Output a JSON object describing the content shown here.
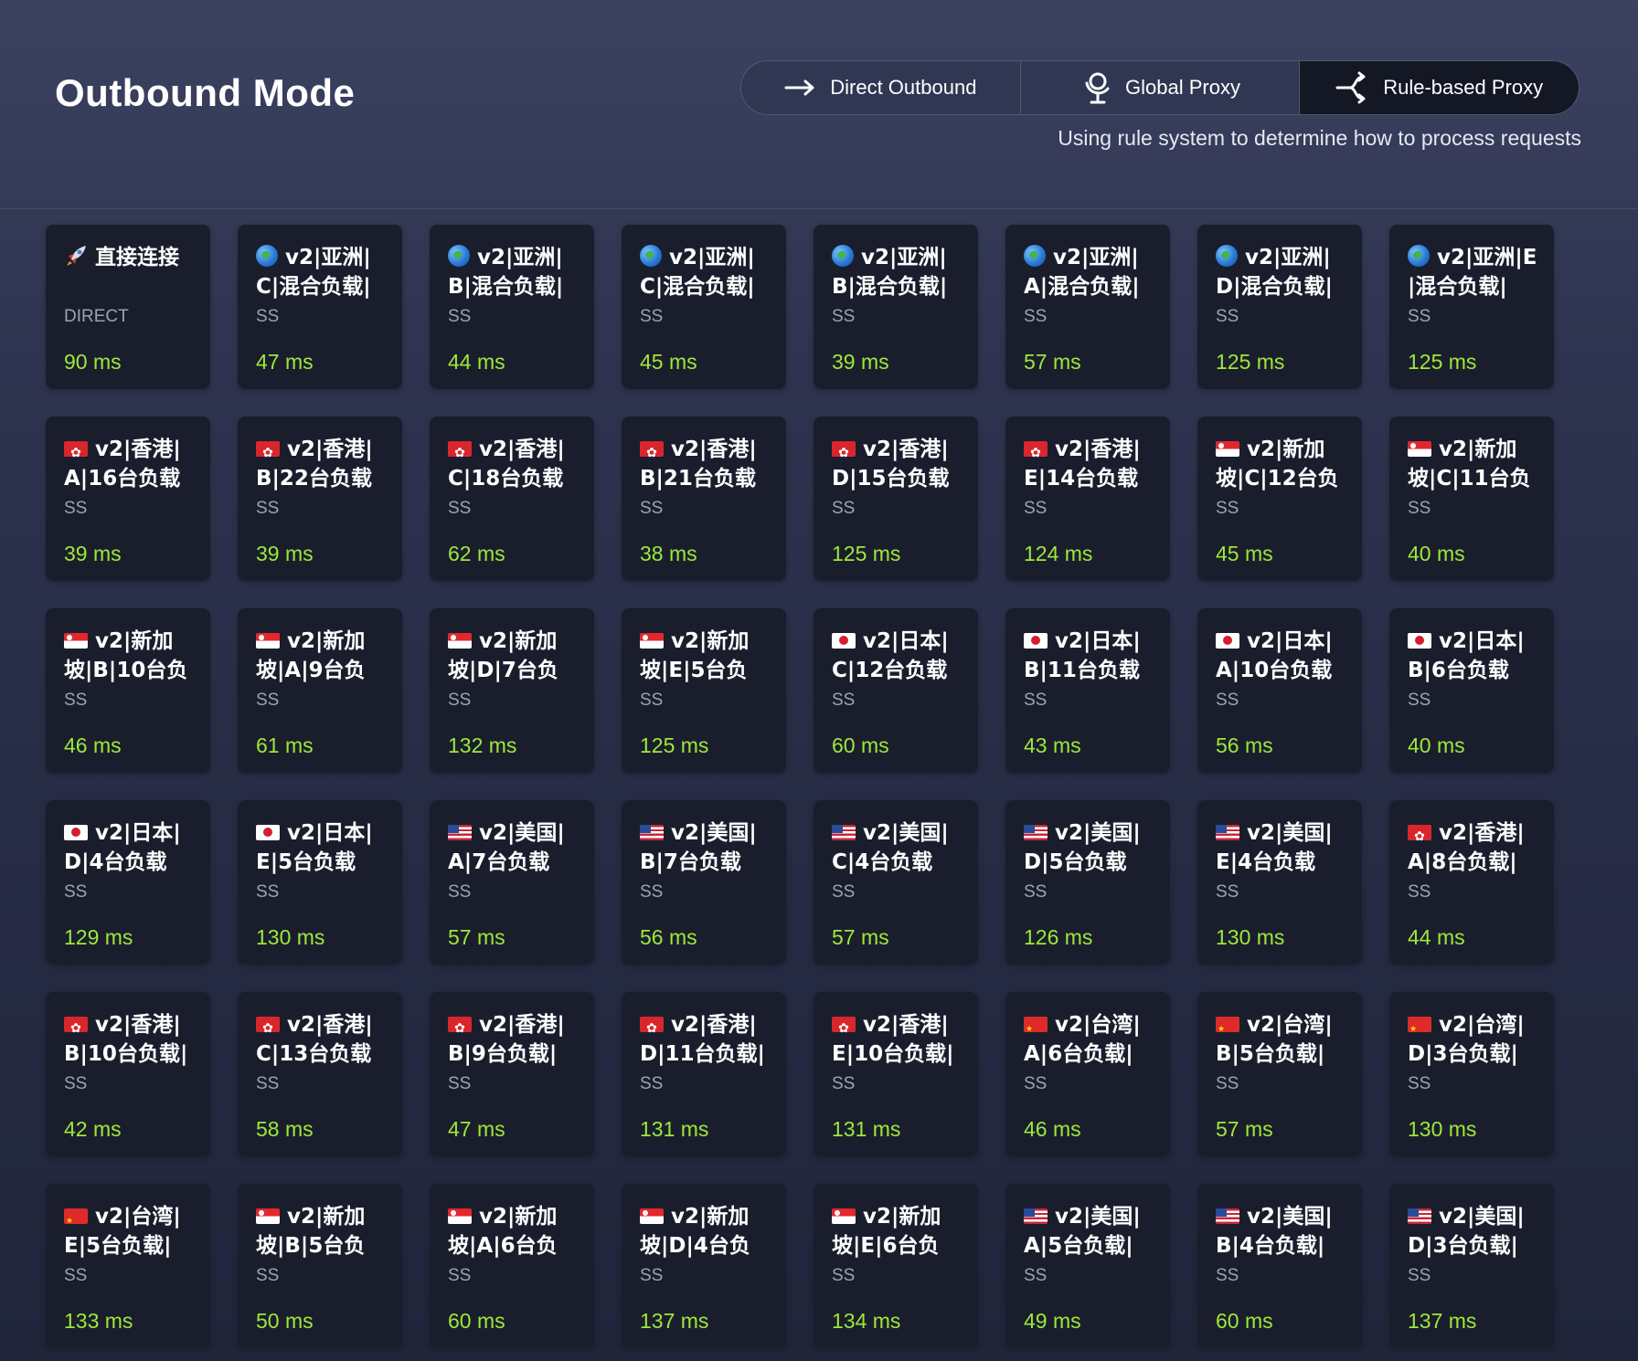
{
  "header": {
    "title": "Outbound Mode",
    "modes": [
      {
        "label": "Direct Outbound",
        "icon": "arrow-right-icon",
        "active": false
      },
      {
        "label": "Global Proxy",
        "icon": "globe-pin-icon",
        "active": false
      },
      {
        "label": "Rule-based Proxy",
        "icon": "split-route-icon",
        "active": true
      }
    ],
    "description": "Using rule system to determine how to process requests"
  },
  "colors": {
    "delay_good": "#9ee83a",
    "card_bg": "#1a1e2c",
    "active_mode_bg": "#141825"
  },
  "proxies": [
    {
      "flag": "rocket",
      "name": "直接连接",
      "type": "DIRECT",
      "delay": "90 ms"
    },
    {
      "flag": "globe",
      "name": "v2|亚洲|C|混合负载|",
      "type": "SS",
      "delay": "47 ms"
    },
    {
      "flag": "globe",
      "name": "v2|亚洲|B|混合负载|",
      "type": "SS",
      "delay": "44 ms"
    },
    {
      "flag": "globe",
      "name": "v2|亚洲|C|混合负载|",
      "type": "SS",
      "delay": "45 ms"
    },
    {
      "flag": "globe",
      "name": "v2|亚洲|B|混合负载|",
      "type": "SS",
      "delay": "39 ms"
    },
    {
      "flag": "globe",
      "name": "v2|亚洲|A|混合负载|",
      "type": "SS",
      "delay": "57 ms"
    },
    {
      "flag": "globe",
      "name": "v2|亚洲|D|混合负载|",
      "type": "SS",
      "delay": "125 ms"
    },
    {
      "flag": "globe",
      "name": "v2|亚洲|E|混合负载|",
      "type": "SS",
      "delay": "125 ms"
    },
    {
      "flag": "hk",
      "name": "v2|香港|A|16台负载",
      "type": "SS",
      "delay": "39 ms"
    },
    {
      "flag": "hk",
      "name": "v2|香港|B|22台负载",
      "type": "SS",
      "delay": "39 ms"
    },
    {
      "flag": "hk",
      "name": "v2|香港|C|18台负载",
      "type": "SS",
      "delay": "62 ms"
    },
    {
      "flag": "hk",
      "name": "v2|香港|B|21台负载",
      "type": "SS",
      "delay": "38 ms"
    },
    {
      "flag": "hk",
      "name": "v2|香港|D|15台负载",
      "type": "SS",
      "delay": "125 ms"
    },
    {
      "flag": "hk",
      "name": "v2|香港|E|14台负载",
      "type": "SS",
      "delay": "124 ms"
    },
    {
      "flag": "sg",
      "name": "v2|新加坡|C|12台负",
      "type": "SS",
      "delay": "45 ms"
    },
    {
      "flag": "sg",
      "name": "v2|新加坡|C|11台负",
      "type": "SS",
      "delay": "40 ms"
    },
    {
      "flag": "sg",
      "name": "v2|新加坡|B|10台负",
      "type": "SS",
      "delay": "46 ms"
    },
    {
      "flag": "sg",
      "name": "v2|新加坡|A|9台负",
      "type": "SS",
      "delay": "61 ms"
    },
    {
      "flag": "sg",
      "name": "v2|新加坡|D|7台负",
      "type": "SS",
      "delay": "132 ms"
    },
    {
      "flag": "sg",
      "name": "v2|新加坡|E|5台负",
      "type": "SS",
      "delay": "125 ms"
    },
    {
      "flag": "jp",
      "name": "v2|日本|C|12台负载",
      "type": "SS",
      "delay": "60 ms"
    },
    {
      "flag": "jp",
      "name": "v2|日本|B|11台负载",
      "type": "SS",
      "delay": "43 ms"
    },
    {
      "flag": "jp",
      "name": "v2|日本|A|10台负载",
      "type": "SS",
      "delay": "56 ms"
    },
    {
      "flag": "jp",
      "name": "v2|日本|B|6台负载",
      "type": "SS",
      "delay": "40 ms"
    },
    {
      "flag": "jp",
      "name": "v2|日本|D|4台负载",
      "type": "SS",
      "delay": "129 ms"
    },
    {
      "flag": "jp",
      "name": "v2|日本|E|5台负载",
      "type": "SS",
      "delay": "130 ms"
    },
    {
      "flag": "us",
      "name": "v2|美国|A|7台负载",
      "type": "SS",
      "delay": "57 ms"
    },
    {
      "flag": "us",
      "name": "v2|美国|B|7台负载",
      "type": "SS",
      "delay": "56 ms"
    },
    {
      "flag": "us",
      "name": "v2|美国|C|4台负载",
      "type": "SS",
      "delay": "57 ms"
    },
    {
      "flag": "us",
      "name": "v2|美国|D|5台负载",
      "type": "SS",
      "delay": "126 ms"
    },
    {
      "flag": "us",
      "name": "v2|美国|E|4台负载",
      "type": "SS",
      "delay": "130 ms"
    },
    {
      "flag": "hk",
      "name": "v2|香港|A|8台负载|",
      "type": "SS",
      "delay": "44 ms"
    },
    {
      "flag": "hk",
      "name": "v2|香港|B|10台负载|",
      "type": "SS",
      "delay": "42 ms"
    },
    {
      "flag": "hk",
      "name": "v2|香港|C|13台负载",
      "type": "SS",
      "delay": "58 ms"
    },
    {
      "flag": "hk",
      "name": "v2|香港|B|9台负载|",
      "type": "SS",
      "delay": "47 ms"
    },
    {
      "flag": "hk",
      "name": "v2|香港|D|11台负载|",
      "type": "SS",
      "delay": "131 ms"
    },
    {
      "flag": "hk",
      "name": "v2|香港|E|10台负载|",
      "type": "SS",
      "delay": "131 ms"
    },
    {
      "flag": "cn",
      "name": "v2|台湾|A|6台负载|",
      "type": "SS",
      "delay": "46 ms"
    },
    {
      "flag": "cn",
      "name": "v2|台湾|B|5台负载|",
      "type": "SS",
      "delay": "57 ms"
    },
    {
      "flag": "cn",
      "name": "v2|台湾|D|3台负载|",
      "type": "SS",
      "delay": "130 ms"
    },
    {
      "flag": "cn",
      "name": "v2|台湾|E|5台负载|",
      "type": "SS",
      "delay": "133 ms"
    },
    {
      "flag": "sg",
      "name": "v2|新加坡|B|5台负",
      "type": "SS",
      "delay": "50 ms"
    },
    {
      "flag": "sg",
      "name": "v2|新加坡|A|6台负",
      "type": "SS",
      "delay": "60 ms"
    },
    {
      "flag": "sg",
      "name": "v2|新加坡|D|4台负",
      "type": "SS",
      "delay": "137 ms"
    },
    {
      "flag": "sg",
      "name": "v2|新加坡|E|6台负",
      "type": "SS",
      "delay": "134 ms"
    },
    {
      "flag": "us",
      "name": "v2|美国|A|5台负载|",
      "type": "SS",
      "delay": "49 ms"
    },
    {
      "flag": "us",
      "name": "v2|美国|B|4台负载|",
      "type": "SS",
      "delay": "60 ms"
    },
    {
      "flag": "us",
      "name": "v2|美国|D|3台负载|",
      "type": "SS",
      "delay": "137 ms"
    }
  ]
}
